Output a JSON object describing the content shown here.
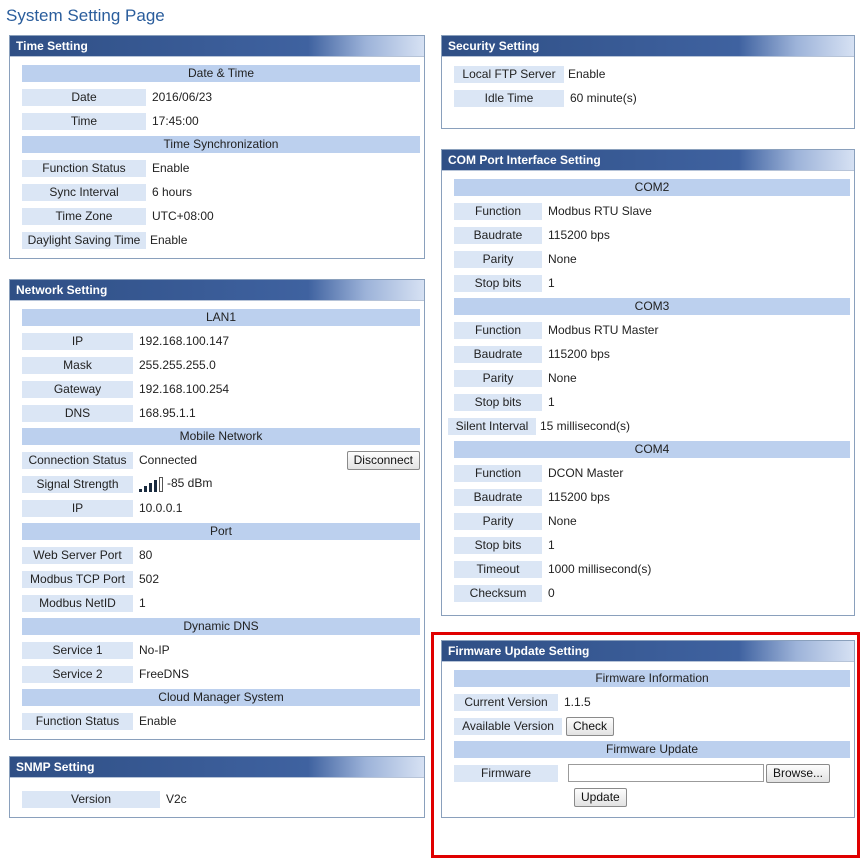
{
  "page_title": "System Setting Page",
  "time_setting": {
    "header": "Time Setting",
    "date_time_header": "Date & Time",
    "date": {
      "label": "Date",
      "value": "2016/06/23"
    },
    "time": {
      "label": "Time",
      "value": "17:45:00"
    },
    "sync_header": "Time Synchronization",
    "function_status": {
      "label": "Function Status",
      "value": "Enable"
    },
    "sync_interval": {
      "label": "Sync Interval",
      "value": "6 hours"
    },
    "time_zone": {
      "label": "Time Zone",
      "value": "UTC+08:00"
    },
    "dst": {
      "label": "Daylight Saving Time",
      "value": "Enable"
    }
  },
  "network_setting": {
    "header": "Network Setting",
    "lan_header": "LAN1",
    "ip": {
      "label": "IP",
      "value": "192.168.100.147"
    },
    "mask": {
      "label": "Mask",
      "value": "255.255.255.0"
    },
    "gateway": {
      "label": "Gateway",
      "value": "192.168.100.254"
    },
    "dns": {
      "label": "DNS",
      "value": "168.95.1.1"
    },
    "mobile_header": "Mobile Network",
    "connection_status": {
      "label": "Connection Status",
      "value": "Connected"
    },
    "disconnect_label": "Disconnect",
    "signal_strength": {
      "label": "Signal Strength",
      "value": "-85 dBm",
      "icon": "signal-bars-icon"
    },
    "mobile_ip": {
      "label": "IP",
      "value": "10.0.0.1"
    },
    "port_header": "Port",
    "web_server_port": {
      "label": "Web Server Port",
      "value": "80"
    },
    "modbus_tcp_port": {
      "label": "Modbus TCP Port",
      "value": "502"
    },
    "modbus_netid": {
      "label": "Modbus NetID",
      "value": "1"
    },
    "ddns_header": "Dynamic DNS",
    "service1": {
      "label": "Service 1",
      "value": "No-IP"
    },
    "service2": {
      "label": "Service 2",
      "value": "FreeDNS"
    },
    "cloud_header": "Cloud Manager System",
    "cloud_function_status": {
      "label": "Function Status",
      "value": "Enable"
    }
  },
  "snmp_setting": {
    "header": "SNMP Setting",
    "version": {
      "label": "Version",
      "value": "V2c"
    }
  },
  "security_setting": {
    "header": "Security Setting",
    "ftp": {
      "label": "Local FTP Server",
      "value": "Enable"
    },
    "idle": {
      "label": "Idle Time",
      "value": "60 minute(s)"
    }
  },
  "com_setting": {
    "header": "COM Port Interface Setting",
    "com2": {
      "header": "COM2",
      "function": {
        "label": "Function",
        "value": "Modbus RTU Slave"
      },
      "baudrate": {
        "label": "Baudrate",
        "value": "115200 bps"
      },
      "parity": {
        "label": "Parity",
        "value": "None"
      },
      "stop_bits": {
        "label": "Stop bits",
        "value": "1"
      }
    },
    "com3": {
      "header": "COM3",
      "function": {
        "label": "Function",
        "value": "Modbus RTU Master"
      },
      "baudrate": {
        "label": "Baudrate",
        "value": "115200 bps"
      },
      "parity": {
        "label": "Parity",
        "value": "None"
      },
      "stop_bits": {
        "label": "Stop bits",
        "value": "1"
      },
      "silent_interval": {
        "label": "Silent Interval",
        "value": "15 millisecond(s)"
      }
    },
    "com4": {
      "header": "COM4",
      "function": {
        "label": "Function",
        "value": "DCON Master"
      },
      "baudrate": {
        "label": "Baudrate",
        "value": "115200 bps"
      },
      "parity": {
        "label": "Parity",
        "value": "None"
      },
      "stop_bits": {
        "label": "Stop bits",
        "value": "1"
      },
      "timeout": {
        "label": "Timeout",
        "value": "1000 millisecond(s)"
      },
      "checksum": {
        "label": "Checksum",
        "value": "0"
      }
    }
  },
  "firmware_setting": {
    "header": "Firmware Update Setting",
    "info_header": "Firmware Information",
    "current_version": {
      "label": "Current Version",
      "value": "1.1.5"
    },
    "available_version": {
      "label": "Available Version"
    },
    "check_label": "Check",
    "update_header": "Firmware Update",
    "firmware": {
      "label": "Firmware",
      "input_value": ""
    },
    "browse_label": "Browse...",
    "update_label": "Update"
  },
  "colors": {
    "highlight": "#e00000",
    "header_bg": "#2f4f85",
    "section_bg": "#bcd0ee",
    "label_bg": "#dbe6f5"
  }
}
